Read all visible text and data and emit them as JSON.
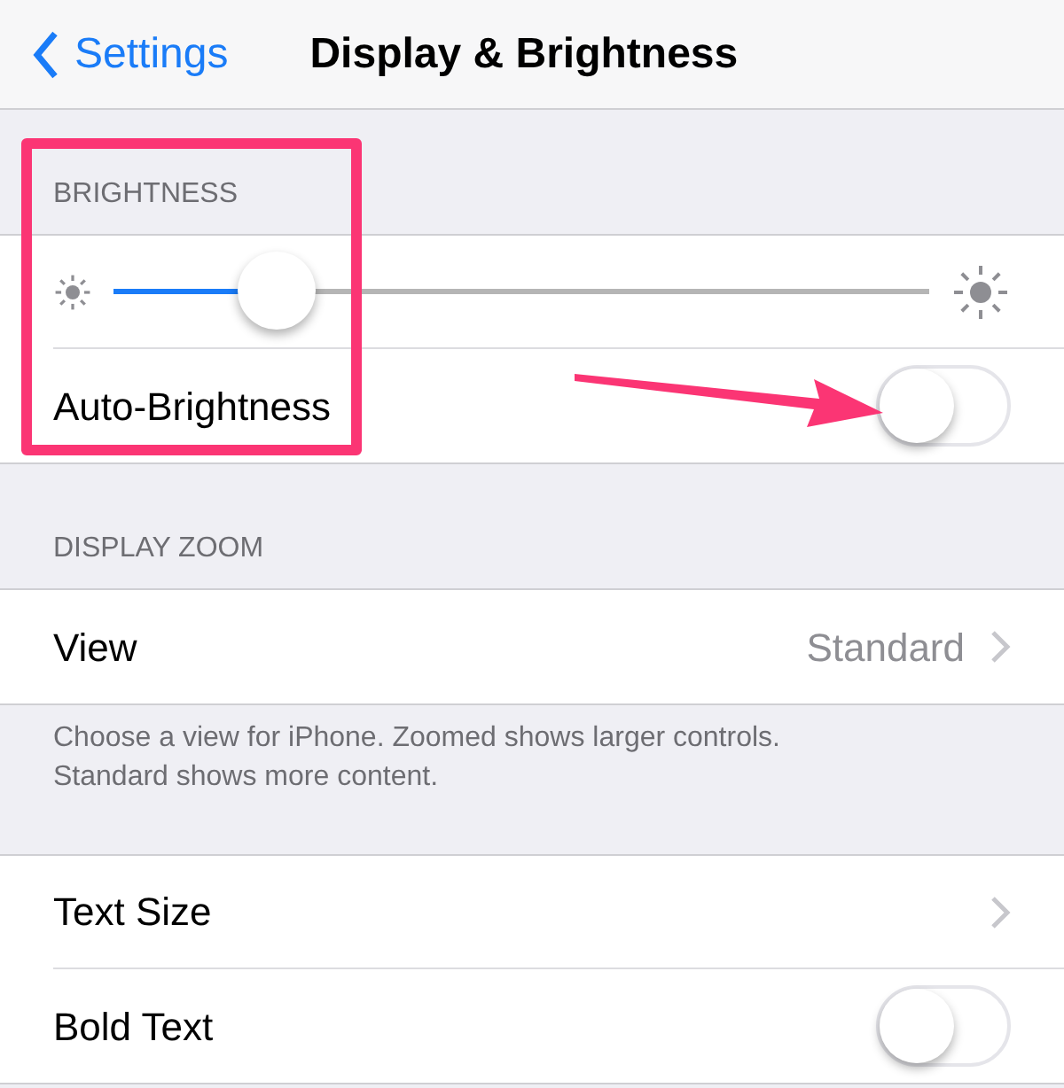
{
  "nav": {
    "back": "Settings",
    "title": "Display & Brightness"
  },
  "sections": [
    {
      "header": "BRIGHTNESS",
      "rows": [
        {
          "kind": "slider",
          "level": 0.2
        },
        {
          "kind": "toggle",
          "label": "Auto-Brightness",
          "on": false
        }
      ]
    },
    {
      "header": "DISPLAY ZOOM",
      "rows": [
        {
          "kind": "link",
          "label": "View",
          "value": "Standard"
        }
      ],
      "footer": "Choose a view for iPhone. Zoomed shows larger controls.\nStandard shows more content."
    },
    {
      "rows": [
        {
          "kind": "link",
          "label": "Text Size"
        },
        {
          "kind": "toggle",
          "label": "Bold Text",
          "on": false
        }
      ]
    }
  ]
}
